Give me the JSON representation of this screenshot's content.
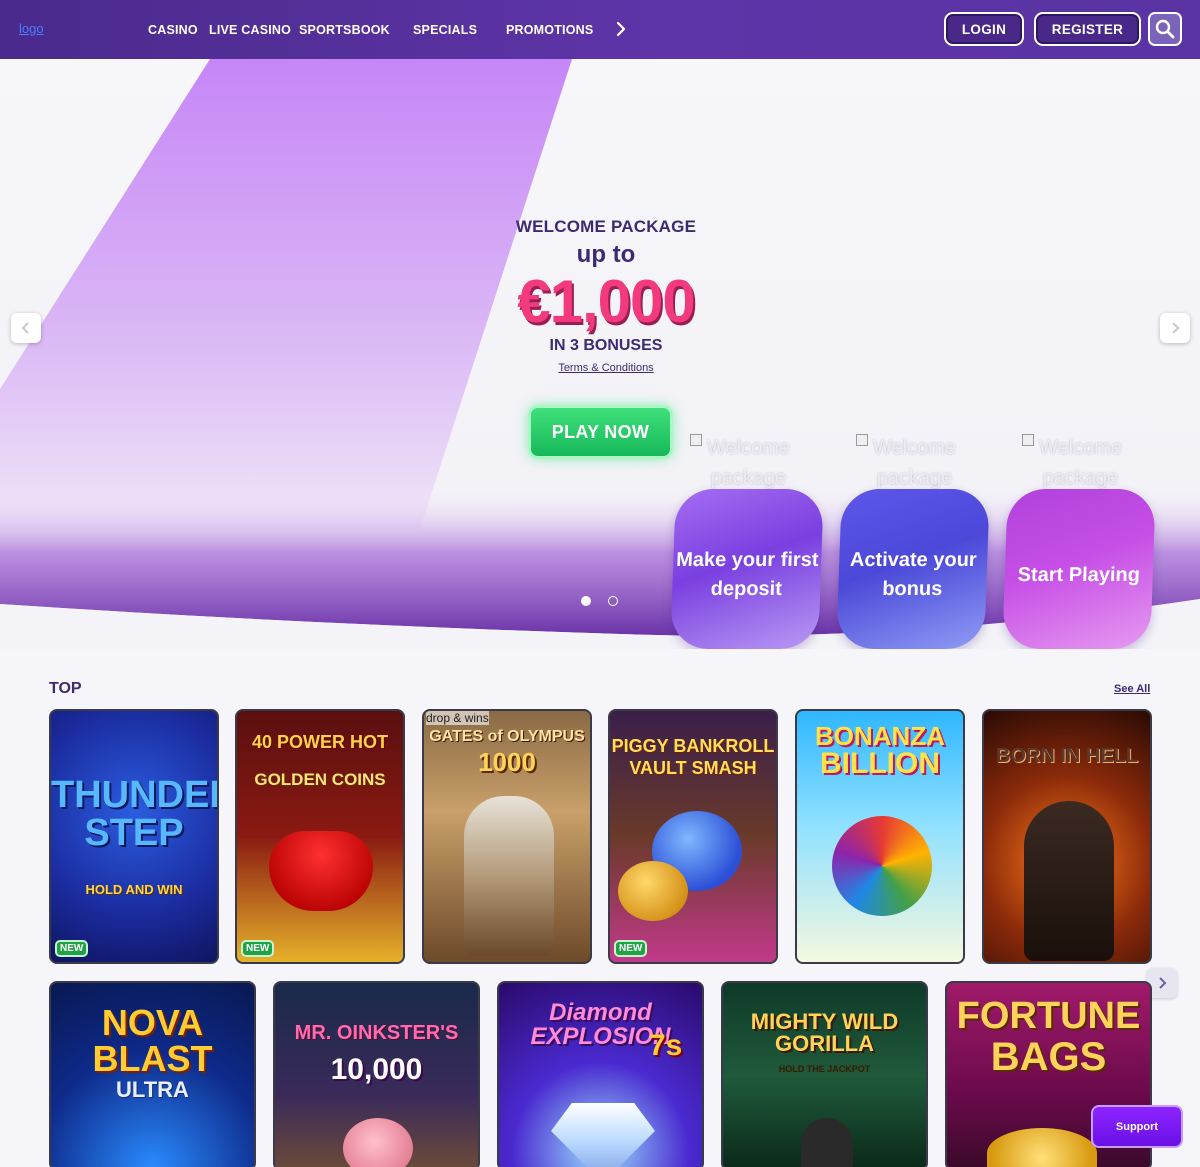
{
  "header": {
    "logo_alt": "logo",
    "nav": [
      "CASINO",
      "LIVE CASINO",
      "SPORTSBOOK",
      "SPECIALS",
      "PROMOTIONS"
    ],
    "login": "LOGIN",
    "register": "REGISTER"
  },
  "hero": {
    "title": "WELCOME PACKAGE",
    "upto": "up to",
    "amount": "€1,000",
    "bonuses": "IN 3 BONUSES",
    "terms": "Terms & Conditions",
    "cta": "PLAY NOW",
    "step_alt": "Welcome package",
    "steps": [
      "Make your first deposit",
      "Activate your bonus",
      "Start Playing"
    ],
    "slides": 2,
    "active_slide": 1
  },
  "top": {
    "title": "TOP",
    "see_all": "See All",
    "badge": "NEW",
    "broken_alt": "drop & wins",
    "games_row1": [
      {
        "name": "THUNDER STEP",
        "sub": "HOLD AND WIN"
      },
      {
        "name": "40 POWER HOT",
        "sub": "GOLDEN COINS"
      },
      {
        "name": "GATES of OLYMPUS",
        "sub": "1000"
      },
      {
        "name": "PIGGY BANKROLL",
        "sub": "VAULT SMASH"
      },
      {
        "name": "BONANZA",
        "sub": "BILLION"
      },
      {
        "name": "BORN IN HELL",
        "sub": ""
      }
    ],
    "games_row2": [
      {
        "name": "NOVA BLAST",
        "sub": "ULTRA"
      },
      {
        "name": "MR. OINKSTER'S",
        "sub": "10,000"
      },
      {
        "name": "Diamond EXPLOSION",
        "sub": "7s"
      },
      {
        "name": "MIGHTY WILD GORILLA",
        "sub": "HOLD THE JACKPOT"
      },
      {
        "name": "FORTUNE",
        "sub": "BAGS"
      }
    ]
  },
  "support": "Support"
}
